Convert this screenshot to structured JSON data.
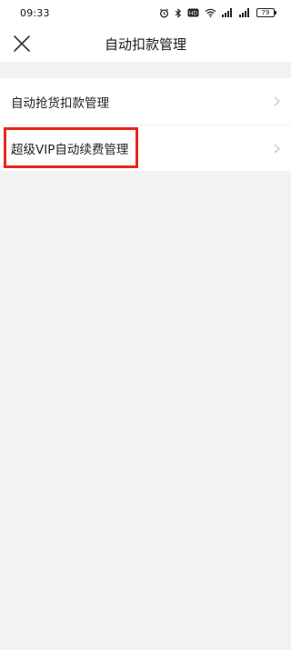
{
  "status_bar": {
    "time": "09:33",
    "battery_level": "79",
    "icons": [
      "alarm-icon",
      "bluetooth-icon",
      "hd-icon",
      "wifi-icon",
      "signal-icon-1",
      "signal-icon-2",
      "battery-icon"
    ]
  },
  "nav": {
    "title": "自动扣款管理",
    "close_icon": "close-icon"
  },
  "list": {
    "items": [
      {
        "label": "自动抢货扣款管理",
        "icon": "chevron-right-icon"
      },
      {
        "label": "超级VIP自动续费管理",
        "icon": "chevron-right-icon"
      }
    ]
  },
  "colors": {
    "background": "#f2f2f4",
    "card": "#ffffff",
    "highlight": "#e8271e",
    "chevron": "#c4c4c4"
  }
}
